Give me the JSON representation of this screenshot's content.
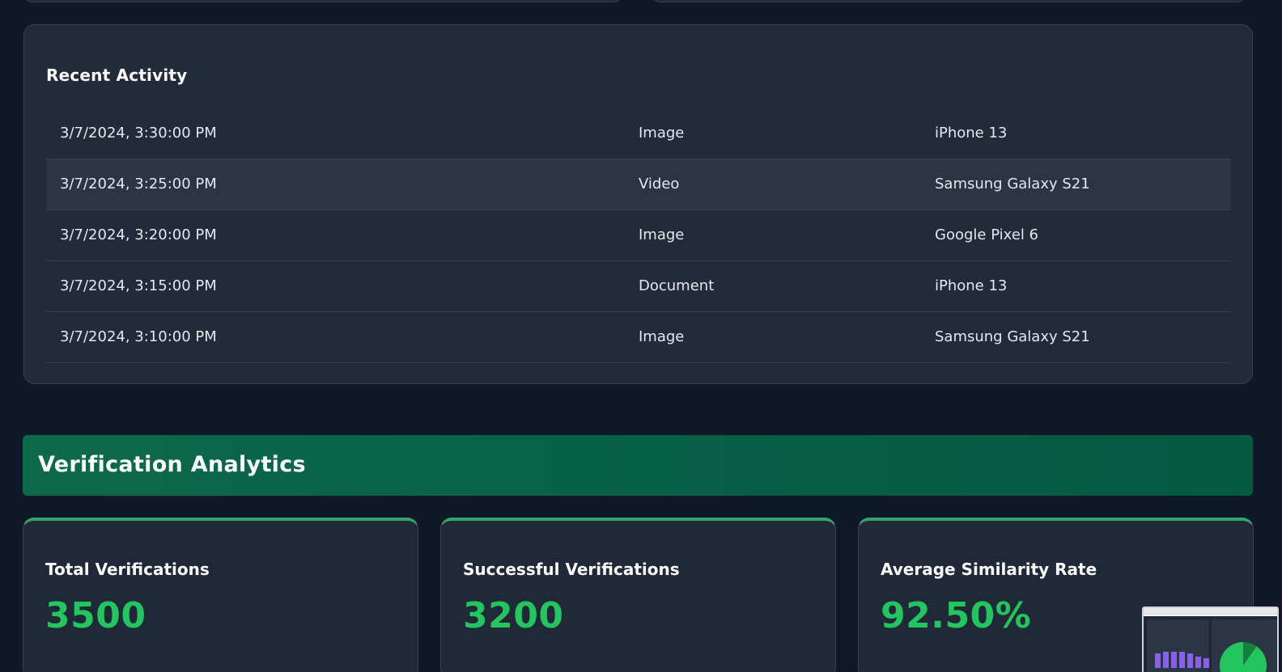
{
  "recent_activity": {
    "title": "Recent Activity",
    "rows": [
      {
        "time": "3/7/2024, 3:30:00 PM",
        "type": "Image",
        "device": "iPhone 13"
      },
      {
        "time": "3/7/2024, 3:25:00 PM",
        "type": "Video",
        "device": "Samsung Galaxy S21"
      },
      {
        "time": "3/7/2024, 3:20:00 PM",
        "type": "Image",
        "device": "Google Pixel 6"
      },
      {
        "time": "3/7/2024, 3:15:00 PM",
        "type": "Document",
        "device": "iPhone 13"
      },
      {
        "time": "3/7/2024, 3:10:00 PM",
        "type": "Image",
        "device": "Samsung Galaxy S21"
      }
    ]
  },
  "analytics": {
    "title": "Verification Analytics",
    "stats": [
      {
        "label": "Total Verifications",
        "value": "3500"
      },
      {
        "label": "Successful Verifications",
        "value": "3200"
      },
      {
        "label": "Average Similarity Rate",
        "value": "92.50%"
      }
    ]
  },
  "colors": {
    "background": "#111827",
    "card": "#1f2937",
    "accent_green": "#22c55e",
    "header_green": "#065f46"
  }
}
